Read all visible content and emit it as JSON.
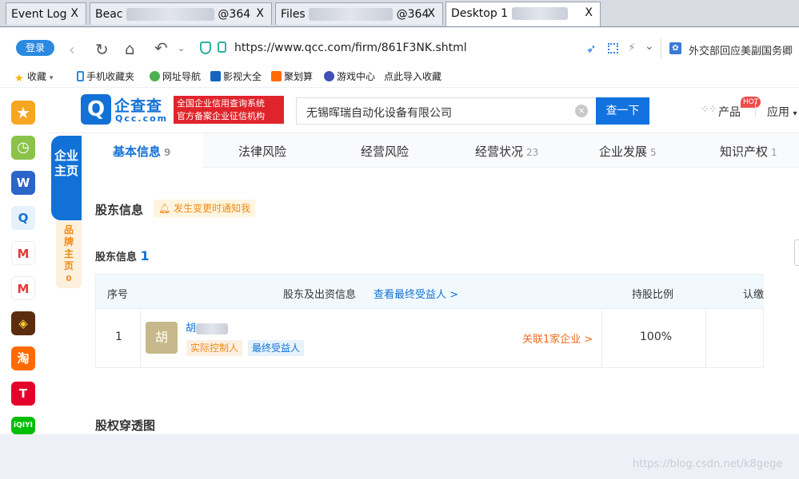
{
  "browser": {
    "tabs": [
      {
        "title": "Event Log",
        "close": "X"
      },
      {
        "title": "Beac",
        "suffix": "@364",
        "close": "X"
      },
      {
        "title": "Files",
        "suffix": "@364",
        "close": "X"
      },
      {
        "title": "Desktop 1",
        "close": "X"
      }
    ],
    "login_label": "登录",
    "url": "https://www.qcc.com/firm/861F3NK.shtml",
    "news_headline": "外交部回应美副国务卿",
    "bookmarks": [
      "收藏",
      "手机收藏夹",
      "网址导航",
      "影视大全",
      "聚划算",
      "游戏中心",
      "点此导入收藏"
    ]
  },
  "apps": [
    "star",
    "clock",
    "word",
    "qcc",
    "gmail",
    "gmail",
    "game",
    "taobao",
    "tmall",
    "iqiyi"
  ],
  "app_labels": {
    "taobao": "淘",
    "tmall": "T",
    "iqiyi": "iQIYI",
    "word": "W",
    "gmail": "M"
  },
  "qcc": {
    "logo_icon": "Q",
    "logo_cn": "企查查",
    "logo_en": "Qcc.com",
    "badge_line1": "全国企业信用查询系统",
    "badge_line2": "官方备案企业征信机构",
    "search_value": "无锡晖瑞自动化设备有限公司",
    "search_button": "查一下",
    "clear_icon": "×",
    "product": "产品",
    "hot": "HOT",
    "apps_menu": "应用"
  },
  "side": {
    "company_home": "企业主页",
    "brand_home": "品牌主页",
    "brand_count": "0"
  },
  "page_tabs": [
    {
      "label": "基本信息",
      "count": "9"
    },
    {
      "label": "法律风险",
      "count": ""
    },
    {
      "label": "经营风险",
      "count": ""
    },
    {
      "label": "经营状况",
      "count": "23"
    },
    {
      "label": "企业发展",
      "count": "5"
    },
    {
      "label": "知识产权",
      "count": "1"
    }
  ],
  "shareholders": {
    "section_title": "股东信息",
    "notice": "发生变更时通知我",
    "sub_title": "股东信息",
    "sub_count": "1",
    "headers": {
      "index": "序号",
      "info": "股东及出资信息",
      "link": "查看最终受益人 >",
      "ratio": "持股比例",
      "subscribed": "认缴"
    },
    "rows": [
      {
        "index": "1",
        "avatar": "胡",
        "name": "胡",
        "tags": [
          "实际控制人",
          "最终受益人"
        ],
        "related": "关联1家企业 >",
        "ratio": "100%"
      }
    ]
  },
  "equity_title": "股权穿透图",
  "watermark": "https://blog.csdn.net/k8gege"
}
